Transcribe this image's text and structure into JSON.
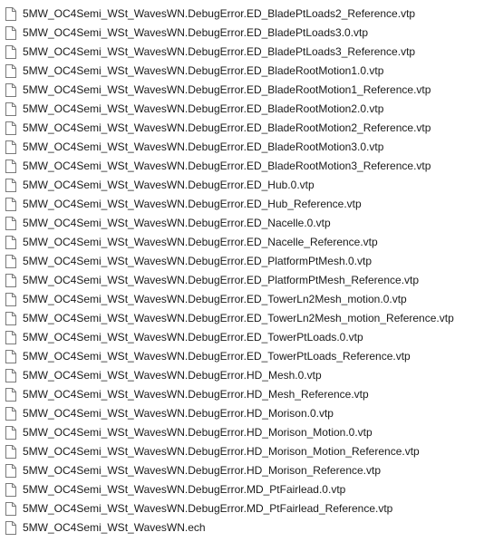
{
  "files": [
    {
      "name": "5MW_OC4Semi_WSt_WavesWN.DebugError.ED_BladePtLoads2_Reference.vtp",
      "icon": "file-icon"
    },
    {
      "name": "5MW_OC4Semi_WSt_WavesWN.DebugError.ED_BladePtLoads3.0.vtp",
      "icon": "file-icon"
    },
    {
      "name": "5MW_OC4Semi_WSt_WavesWN.DebugError.ED_BladePtLoads3_Reference.vtp",
      "icon": "file-icon"
    },
    {
      "name": "5MW_OC4Semi_WSt_WavesWN.DebugError.ED_BladeRootMotion1.0.vtp",
      "icon": "file-icon"
    },
    {
      "name": "5MW_OC4Semi_WSt_WavesWN.DebugError.ED_BladeRootMotion1_Reference.vtp",
      "icon": "file-icon"
    },
    {
      "name": "5MW_OC4Semi_WSt_WavesWN.DebugError.ED_BladeRootMotion2.0.vtp",
      "icon": "file-icon"
    },
    {
      "name": "5MW_OC4Semi_WSt_WavesWN.DebugError.ED_BladeRootMotion2_Reference.vtp",
      "icon": "file-icon"
    },
    {
      "name": "5MW_OC4Semi_WSt_WavesWN.DebugError.ED_BladeRootMotion3.0.vtp",
      "icon": "file-icon"
    },
    {
      "name": "5MW_OC4Semi_WSt_WavesWN.DebugError.ED_BladeRootMotion3_Reference.vtp",
      "icon": "file-icon"
    },
    {
      "name": "5MW_OC4Semi_WSt_WavesWN.DebugError.ED_Hub.0.vtp",
      "icon": "file-icon"
    },
    {
      "name": "5MW_OC4Semi_WSt_WavesWN.DebugError.ED_Hub_Reference.vtp",
      "icon": "file-icon"
    },
    {
      "name": "5MW_OC4Semi_WSt_WavesWN.DebugError.ED_Nacelle.0.vtp",
      "icon": "file-icon"
    },
    {
      "name": "5MW_OC4Semi_WSt_WavesWN.DebugError.ED_Nacelle_Reference.vtp",
      "icon": "file-icon"
    },
    {
      "name": "5MW_OC4Semi_WSt_WavesWN.DebugError.ED_PlatformPtMesh.0.vtp",
      "icon": "file-icon"
    },
    {
      "name": "5MW_OC4Semi_WSt_WavesWN.DebugError.ED_PlatformPtMesh_Reference.vtp",
      "icon": "file-icon"
    },
    {
      "name": "5MW_OC4Semi_WSt_WavesWN.DebugError.ED_TowerLn2Mesh_motion.0.vtp",
      "icon": "file-icon"
    },
    {
      "name": "5MW_OC4Semi_WSt_WavesWN.DebugError.ED_TowerLn2Mesh_motion_Reference.vtp",
      "icon": "file-icon"
    },
    {
      "name": "5MW_OC4Semi_WSt_WavesWN.DebugError.ED_TowerPtLoads.0.vtp",
      "icon": "file-icon"
    },
    {
      "name": "5MW_OC4Semi_WSt_WavesWN.DebugError.ED_TowerPtLoads_Reference.vtp",
      "icon": "file-icon"
    },
    {
      "name": "5MW_OC4Semi_WSt_WavesWN.DebugError.HD_Mesh.0.vtp",
      "icon": "file-icon"
    },
    {
      "name": "5MW_OC4Semi_WSt_WavesWN.DebugError.HD_Mesh_Reference.vtp",
      "icon": "file-icon"
    },
    {
      "name": "5MW_OC4Semi_WSt_WavesWN.DebugError.HD_Morison.0.vtp",
      "icon": "file-icon"
    },
    {
      "name": "5MW_OC4Semi_WSt_WavesWN.DebugError.HD_Morison_Motion.0.vtp",
      "icon": "file-icon"
    },
    {
      "name": "5MW_OC4Semi_WSt_WavesWN.DebugError.HD_Morison_Motion_Reference.vtp",
      "icon": "file-icon"
    },
    {
      "name": "5MW_OC4Semi_WSt_WavesWN.DebugError.HD_Morison_Reference.vtp",
      "icon": "file-icon"
    },
    {
      "name": "5MW_OC4Semi_WSt_WavesWN.DebugError.MD_PtFairlead.0.vtp",
      "icon": "file-icon"
    },
    {
      "name": "5MW_OC4Semi_WSt_WavesWN.DebugError.MD_PtFairlead_Reference.vtp",
      "icon": "file-icon"
    },
    {
      "name": "5MW_OC4Semi_WSt_WavesWN.ech",
      "icon": "file-icon"
    }
  ],
  "colors": {
    "text": "#1a1a1a",
    "icon_stroke": "#7a7a7a",
    "background": "#ffffff"
  }
}
